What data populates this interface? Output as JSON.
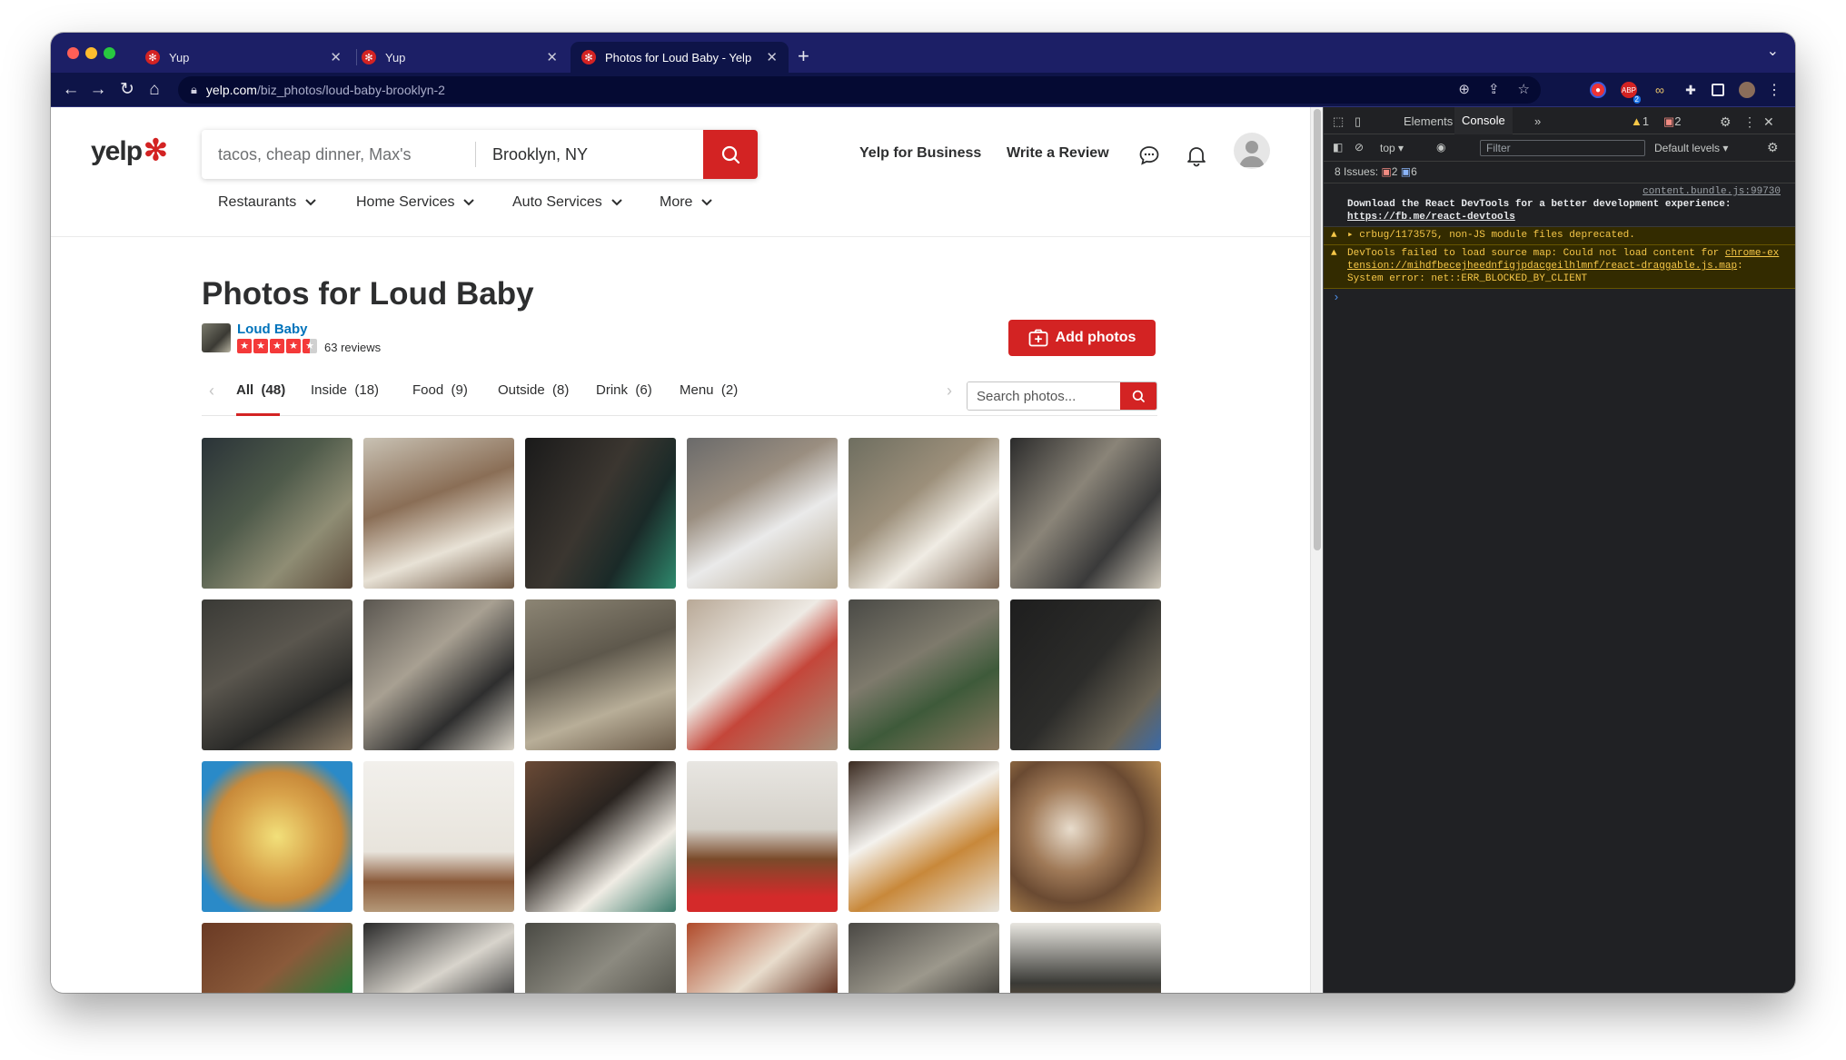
{
  "browser": {
    "tabs": [
      {
        "title": "Yup",
        "favicon": "yelp-burst-icon",
        "active": false
      },
      {
        "title": "Yup",
        "favicon": "yelp-burst-icon",
        "active": false
      },
      {
        "title": "Photos for Loud Baby - Yelp",
        "favicon": "yelp-burst-icon",
        "active": true
      }
    ],
    "url_host": "yelp.com",
    "url_path": "/biz_photos/loud-baby-brooklyn-2",
    "extension_badge": "2"
  },
  "header": {
    "logo_text": "yelp",
    "search_find_placeholder": "tacos, cheap dinner, Max's",
    "search_near_value": "Brooklyn, NY",
    "links": {
      "business": "Yelp for Business",
      "write_review": "Write a Review"
    },
    "categories": [
      "Restaurants",
      "Home Services",
      "Auto Services",
      "More"
    ]
  },
  "content": {
    "title": "Photos for Loud Baby",
    "business_name": "Loud Baby",
    "rating": 4.5,
    "reviews_label": "63 reviews",
    "add_photos_label": "Add photos",
    "photo_tabs": [
      {
        "label": "All",
        "count": "(48)",
        "active": true
      },
      {
        "label": "Inside",
        "count": "(18)",
        "active": false
      },
      {
        "label": "Food",
        "count": "(9)",
        "active": false
      },
      {
        "label": "Outside",
        "count": "(8)",
        "active": false
      },
      {
        "label": "Drink",
        "count": "(6)",
        "active": false
      },
      {
        "label": "Menu",
        "count": "(2)",
        "active": false
      }
    ],
    "search_placeholder": "Search photos..."
  },
  "devtools": {
    "tabs": {
      "elements": "Elements",
      "console": "Console"
    },
    "warning_count": "1",
    "error_count": "2",
    "context": "top",
    "filter_placeholder": "Filter",
    "levels": "Default levels",
    "issues_label": "8 Issues:",
    "issues_errors": "2",
    "issues_info": "6",
    "messages": [
      {
        "type": "info",
        "source": "content.bundle.js:99730",
        "text": "Download the React DevTools for a better development experience: ",
        "link": "https://fb.me/react-devtools"
      },
      {
        "type": "warn",
        "source": "",
        "text": "▸ crbug/1173575, non-JS module files deprecated.",
        "link": ""
      },
      {
        "type": "warn",
        "source": "",
        "text": "DevTools failed to load source map: Could not load content for ",
        "link": "chrome-extension://mihdfbecejheednfigjpdacgeilhlmnf/react-draggable.js.map",
        "suffix": ": System error: net::ERR_BLOCKED_BY_CLIENT"
      }
    ]
  },
  "colors": {
    "yelp_red": "#d32323",
    "link_blue": "#0073bb",
    "tab_strip": "#1c1f66"
  }
}
